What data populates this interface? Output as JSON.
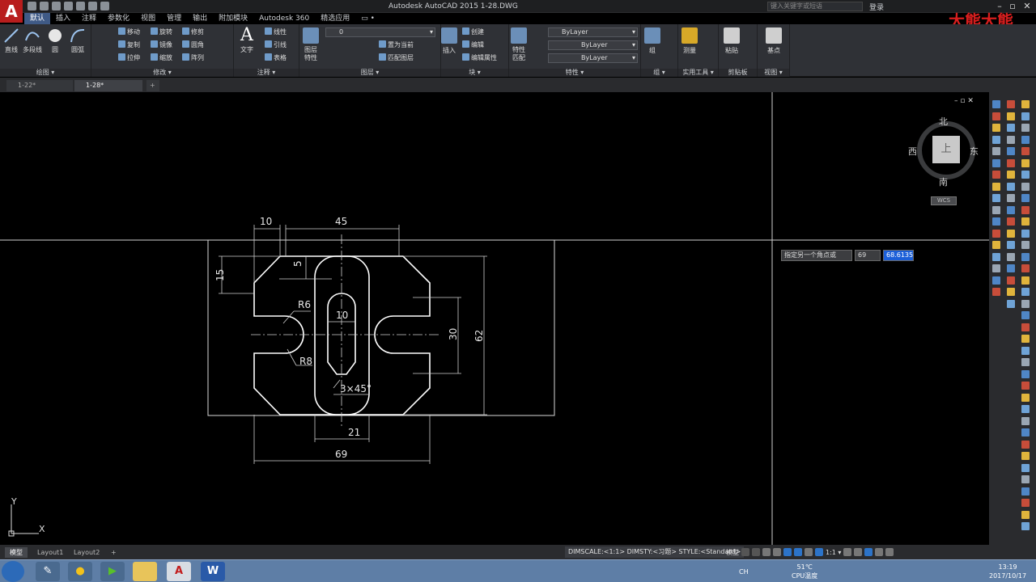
{
  "titlebar": {
    "app_title": "Autodesk AutoCAD 2015    1-28.DWG",
    "search_placeholder": "键入关键字或短语",
    "login_label": "登录",
    "watermark": "大熊大熊"
  },
  "ribbon_tabs": [
    "默认",
    "插入",
    "注释",
    "参数化",
    "视图",
    "管理",
    "输出",
    "附加模块",
    "Autodesk 360",
    "精选应用",
    "▭ •"
  ],
  "ribbon": {
    "draw": {
      "label": "绘图 ▾",
      "line": "直线",
      "polyline": "多段线",
      "circle": "圆",
      "arc": "圆弧"
    },
    "modify": {
      "label": "修改 ▾",
      "move": "移动",
      "rotate": "旋转",
      "trim": "修剪",
      "copy": "复制",
      "mirror": "镜像",
      "fillet": "圆角",
      "stretch": "拉伸",
      "scale": "缩放",
      "array": "阵列"
    },
    "annotation": {
      "label": "注释 ▾",
      "text": "文字",
      "linear": "线性",
      "leader": "引线",
      "table": "表格"
    },
    "layers": {
      "label": "图层 ▾",
      "props": "图层\n特性",
      "current_layer": "0",
      "set_current": "置为当前",
      "match": "匹配图层"
    },
    "block": {
      "label": "块 ▾",
      "insert": "插入",
      "create": "创建",
      "edit": "编辑",
      "edit_attr": "编辑属性"
    },
    "properties": {
      "label": "特性 ▾",
      "match": "特性\n匹配",
      "color": "ByLayer",
      "linetype": "ByLayer",
      "lineweight": "ByLayer"
    },
    "group": {
      "label": "组 ▾",
      "group": "组"
    },
    "utilities": {
      "label": "实用工具 ▾",
      "measure": "测量"
    },
    "clipboard": {
      "label": "剪贴板",
      "paste": "粘贴"
    },
    "view": {
      "label": "视图 ▾",
      "base": "基点"
    }
  },
  "doc_tabs": [
    "1-22*",
    "1-28*"
  ],
  "viewcube": {
    "north": "北",
    "south": "南",
    "east": "东",
    "west": "西",
    "top": "上",
    "wcs": "WCS"
  },
  "prompt": {
    "label": "指定另一个角点或",
    "value1": "69",
    "value2": "68.6135"
  },
  "drawing": {
    "dims": {
      "w10": "10",
      "w45": "45",
      "h5": "5",
      "h15": "15",
      "r6": "R6",
      "w10b": "10",
      "r8": "R8",
      "h30": "30",
      "h62": "62",
      "chamfer": "3×45°",
      "w21": "21",
      "w69": "69"
    }
  },
  "ucs": {
    "y": "Y",
    "x": "X"
  },
  "layout_tabs": [
    "模型",
    "Layout1",
    "Layout2",
    "+"
  ],
  "status": {
    "dim_info": "DIMSCALE:<1:1> DIMSTY:<习题> STYLE:<Standard>",
    "model": "模型",
    "scale": "1:1 ▾"
  },
  "taskbar": {
    "temp": "51℃",
    "cpu": "CPU温度",
    "time": "13:19",
    "date": "2017/10/17",
    "lang": "CH"
  },
  "colors": {
    "accent": "#b81d1d",
    "ribbon": "#2f3136",
    "canvas": "#000000",
    "selection": "#1b5fd8"
  }
}
